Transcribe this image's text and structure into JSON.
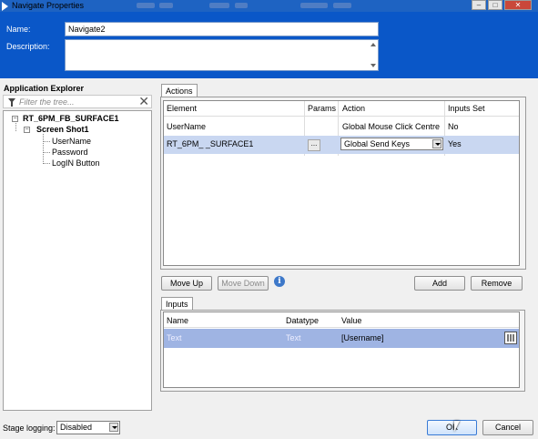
{
  "window": {
    "title": "Navigate Properties",
    "controls": [
      "–",
      "□",
      "✕"
    ]
  },
  "header": {
    "name_label": "Name:",
    "name_value": "Navigate2",
    "description_label": "Description:",
    "description_value": ""
  },
  "explorer": {
    "title": "Application Explorer",
    "filter_placeholder": "Filter the tree...",
    "root": "RT_6PM_FB_SURFACE1",
    "screen": "Screen Shot1",
    "elements": [
      "UserName",
      "Password",
      "LogIN Button"
    ]
  },
  "actions": {
    "tab": "Actions",
    "columns": [
      "Element",
      "Params",
      "Action",
      "Inputs Set"
    ],
    "rows": [
      {
        "element": "UserName",
        "params": "",
        "action": "Global Mouse Click Centre",
        "inputs_set": "No"
      },
      {
        "element": "RT_6PM_   _SURFACE1",
        "params": "...",
        "action": "Global Send Keys",
        "inputs_set": "Yes"
      }
    ],
    "buttons": {
      "move_up": "Move Up",
      "move_down": "Move Down",
      "add": "Add",
      "remove": "Remove",
      "info": "i"
    }
  },
  "inputs": {
    "tab": "Inputs",
    "columns": [
      "Name",
      "Datatype",
      "Value"
    ],
    "rows": [
      {
        "name": "Text",
        "datatype": "Text",
        "value": "[Username]"
      }
    ]
  },
  "footer": {
    "stage_logging_label": "Stage logging:",
    "stage_logging_value": "Disabled",
    "ok": "OK",
    "cancel": "Cancel"
  },
  "colors": {
    "header_blue": "#0a57c8",
    "selection": "#c9d7f1"
  }
}
